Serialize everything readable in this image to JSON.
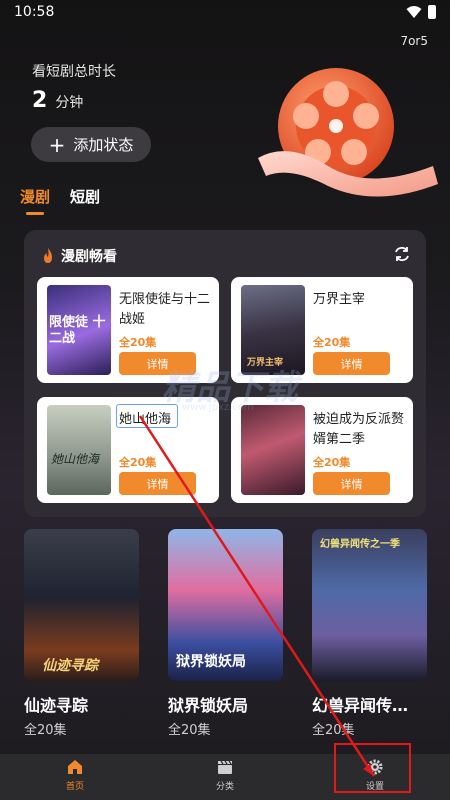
{
  "status_bar": {
    "time": "10:58"
  },
  "corner_tag": "7or5",
  "stats": {
    "label": "看短剧总时长",
    "value": "2",
    "unit": "分钟"
  },
  "add_status": {
    "icon": "plus-icon",
    "label": "添加状态"
  },
  "tabs": [
    {
      "label": "漫剧",
      "active": true
    },
    {
      "label": "短剧",
      "active": false
    }
  ],
  "panel": {
    "title": "漫剧畅看",
    "cards": [
      {
        "title": "无限使徒与十二战姬",
        "count": "全20集",
        "button": "详情",
        "thumb_text": "限使徒 十二战"
      },
      {
        "title": "万界主宰",
        "count": "全20集",
        "button": "详情",
        "thumb_text": "万界主宰"
      },
      {
        "title": "她山他海",
        "count": "全20集",
        "button": "详情",
        "thumb_text": "她山他海"
      },
      {
        "title": "被迫成为反派赘婿第二季",
        "count": "全20集",
        "button": "详情",
        "thumb_text": ""
      }
    ]
  },
  "posters": [
    {
      "title": "仙迹寻踪",
      "count": "全20集",
      "thumb_text": "仙迹寻踪"
    },
    {
      "title": "狱界锁妖局",
      "count": "全20集",
      "thumb_text": "狱界锁妖局"
    },
    {
      "title": "幻兽异闻传…",
      "count": "全20集",
      "thumb_text": "幻兽异闻传之一季"
    }
  ],
  "nav": [
    {
      "label": "首页",
      "icon": "home-icon",
      "active": true
    },
    {
      "label": "分类",
      "icon": "clapperboard-icon",
      "active": false
    },
    {
      "label": "设置",
      "icon": "gear-icon",
      "active": false
    }
  ],
  "watermark": {
    "text": "精品下载",
    "sub": "www.jpxz.com"
  },
  "colors": {
    "accent": "#f08a2c",
    "background": "#1b1a1d",
    "panel": "#2f2d33",
    "annotation": "#e0191b"
  }
}
